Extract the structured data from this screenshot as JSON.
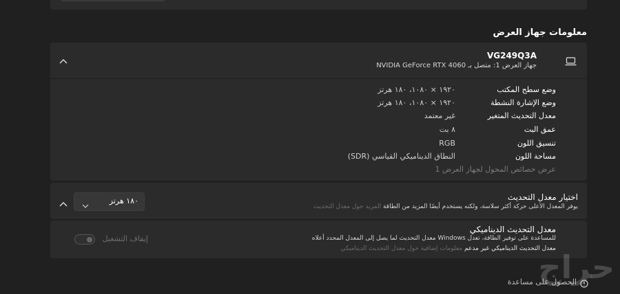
{
  "section_title": "معلومات جهاز العرض",
  "display": {
    "name": "VG249Q3A",
    "connection": "جهاز العرض 1: متصل بـ NVIDIA GeForce RTX 4060",
    "props": [
      {
        "label": "وضع سطح المكتب",
        "value": "١٩٢٠ × ١٠٨٠، ١٨٠ هرتز"
      },
      {
        "label": "وضع الإشارة النشطة",
        "value": "١٩٢٠ × ١٠٨٠، ١٨٠ هرتز"
      },
      {
        "label": "معدل التحديث المتغير",
        "value": "غير معتمد"
      },
      {
        "label": "عمق البت",
        "value": "٨ بت"
      },
      {
        "label": "تنسيق اللون",
        "value": "RGB"
      },
      {
        "label": "مساحة اللون",
        "value": "النطاق الديناميكي القياسي (SDR)"
      }
    ],
    "adapter_link": "عرض خصائص المحول لجهاز العرض 1"
  },
  "refresh": {
    "title": "اختيار معدل التحديث",
    "description": "يوفر المعدل الأعلى حركة أكثر سلاسة، ولكنه يستخدم أيضًا المزيد من الطاقة",
    "link": "المزيد حول معدل التحديث",
    "selected": "١٨٠ هرتز"
  },
  "dynamic": {
    "title": "معدل التحديث الديناميكي",
    "description": "للمساعدة على توفير الطاقة، تعدل Windows معدل التحديث لما يصل إلى المعدل المحدد أعلاه",
    "unsupported": "معدل التحديث الديناميكي غير مدعم",
    "link": "معلومات إضافية حول معدل التحديث الديناميكي",
    "toggle_label": "إيقاف التشغيل"
  },
  "footer": {
    "help": "الحصول على مساعدة",
    "watermark": "حراج"
  }
}
